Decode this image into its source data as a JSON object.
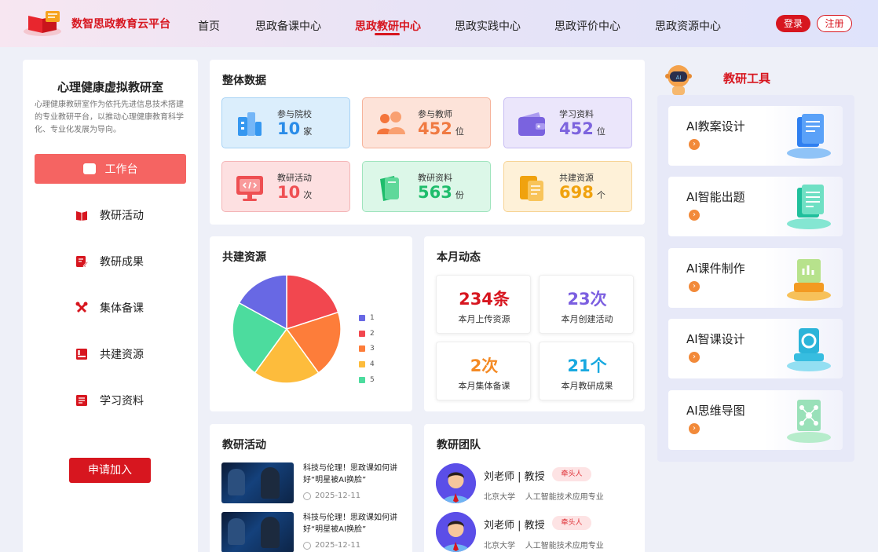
{
  "header": {
    "brand": "数智思政教育云平台",
    "nav": [
      "首页",
      "思政备课中心",
      "思政教研中心",
      "思政实践中心",
      "思政评价中心",
      "思政资源中心"
    ],
    "active_nav": "思政教研中心",
    "login": "登录",
    "register": "注册"
  },
  "colors": {
    "accent": "#d7161f",
    "workbench": "#f56462"
  },
  "left_panel": {
    "title": "心理健康虚拟教研室",
    "description": "心理健康教研室作为依托先进信息技术搭建的专业教研平台，以推动心理健康教育科学化、专业化发展为导向。",
    "workbench": "工作台",
    "menu": [
      {
        "label": "教研活动",
        "icon": "book-icon"
      },
      {
        "label": "教研成果",
        "icon": "edit-document-icon"
      },
      {
        "label": "集体备课",
        "icon": "tools-cross-icon"
      },
      {
        "label": "共建资源",
        "icon": "resource-book-icon"
      },
      {
        "label": "学习资料",
        "icon": "document-icon"
      }
    ],
    "apply": "申请加入"
  },
  "overall": {
    "title": "整体数据",
    "stats": [
      {
        "label": "参与院校",
        "value": "10",
        "unit": "家",
        "icon": "school-building-icon"
      },
      {
        "label": "参与教师",
        "value": "452",
        "unit": "位",
        "icon": "teachers-group-icon"
      },
      {
        "label": "学习资料",
        "value": "452",
        "unit": "位",
        "icon": "wallet-icon"
      },
      {
        "label": "教研活动",
        "value": "10",
        "unit": "次",
        "icon": "monitor-code-icon"
      },
      {
        "label": "教研资料",
        "value": "563",
        "unit": "份",
        "icon": "folder-book-icon"
      },
      {
        "label": "共建资源",
        "value": "698",
        "unit": "个",
        "icon": "document-stack-icon"
      }
    ]
  },
  "shared_resources": {
    "title": "共建资源",
    "legend": [
      "1",
      "2",
      "3",
      "4",
      "5"
    ],
    "slice_values": [
      20,
      20,
      20,
      23,
      17
    ],
    "slice_colors": [
      "#f2474f",
      "#fd7d3a",
      "#fdbc3c",
      "#4cdc9e",
      "#6868e4"
    ]
  },
  "monthly": {
    "title": "本月动态",
    "items": [
      {
        "value": "234条",
        "label": "本月上传资源",
        "color": "#d7161f"
      },
      {
        "value": "23次",
        "label": "本月创建活动",
        "color": "#7b5ee0"
      },
      {
        "value": "2次",
        "label": "本月集体备课",
        "color": "#f48a24"
      },
      {
        "value": "21个",
        "label": "本月教研成果",
        "color": "#19a9e0"
      }
    ]
  },
  "activities": {
    "title": "教研活动",
    "items": [
      {
        "title": "科技与伦理！思政课如何讲好“明星被AI换脸”",
        "date": "2025-12-11"
      },
      {
        "title": "科技与伦理！思政课如何讲好“明星被AI换脸”",
        "date": "2025-12-11"
      }
    ]
  },
  "team": {
    "title": "教研团队",
    "members": [
      {
        "name": "刘老师 | 教授",
        "badge": "牵头人",
        "school": "北京大学",
        "major": "人工智能技术应用专业"
      },
      {
        "name": "刘老师 | 教授",
        "badge": "牵头人",
        "school": "北京大学",
        "major": "人工智能技术应用专业"
      }
    ]
  },
  "tools": {
    "title": "教研工具",
    "robot_label": "AI",
    "items": [
      {
        "name": "AI教案设计",
        "arrow": "›"
      },
      {
        "name": "AI智能出题",
        "arrow": "›"
      },
      {
        "name": "AI课件制作",
        "arrow": "›"
      },
      {
        "name": "AI智课设计",
        "arrow": "›"
      },
      {
        "name": "AI思维导图",
        "arrow": "›"
      }
    ]
  }
}
